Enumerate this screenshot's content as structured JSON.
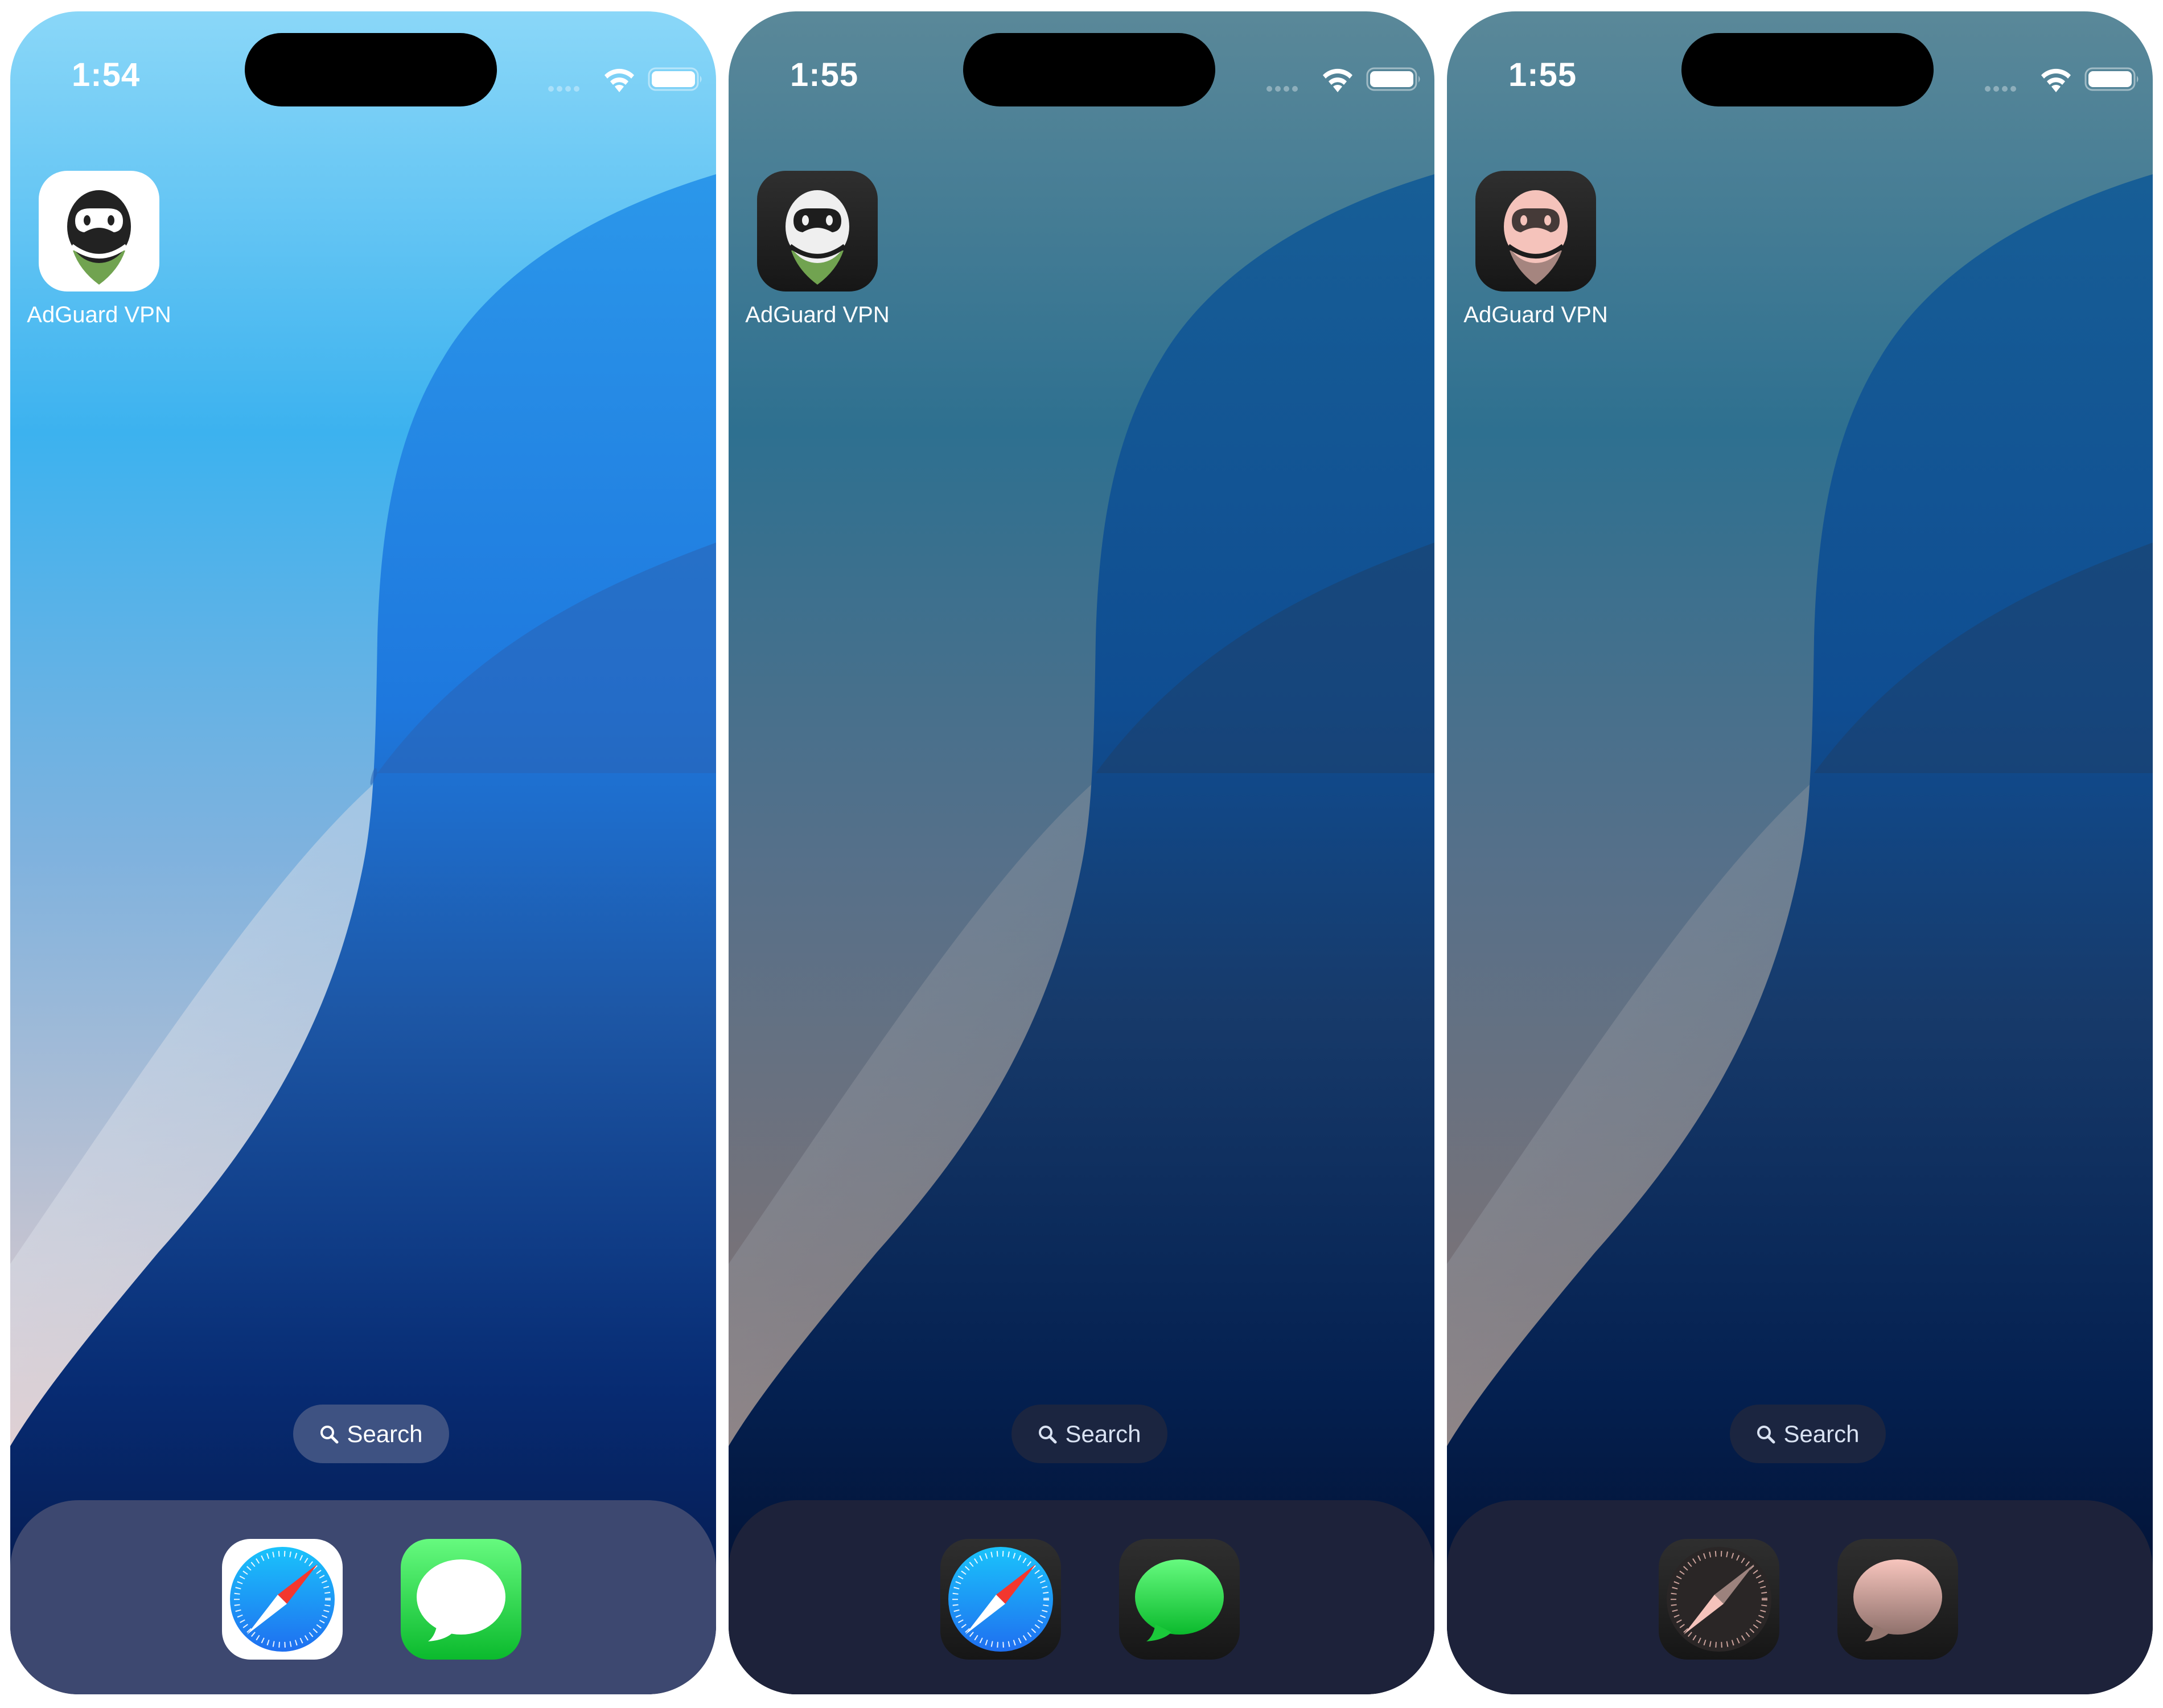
{
  "screens": [
    {
      "variant": "light",
      "time": "1:54",
      "app_label": "AdGuard VPN",
      "search_label": "Search",
      "dock_apps": [
        "Safari",
        "Messages"
      ],
      "battery_level": 1.0,
      "colors": {
        "wall_top": "#8ad7f8",
        "wall_mid": "#3cb2ef",
        "wall_blue": "#1f8de3",
        "wall_deep": "#0a2a6e",
        "wall_bottom": "#061640",
        "band_light": "#dfe8f2",
        "pink": "#f0c6c0",
        "dock": "#3d4971",
        "search_pill": "#3e5282"
      }
    },
    {
      "variant": "dark",
      "time": "1:55",
      "app_label": "AdGuard VPN",
      "search_label": "Search",
      "dock_apps": [
        "Safari",
        "Messages"
      ],
      "battery_level": 1.0,
      "colors": {
        "wall_top": "#5a8899",
        "wall_mid": "#2e7090",
        "wall_blue": "#14548c",
        "wall_deep": "#0b2a5c",
        "wall_bottom": "#020b26",
        "band_light": "#8e99a4",
        "pink": "#98807a",
        "dock": "#1d223a",
        "search_pill": "#1b2540"
      }
    },
    {
      "variant": "tinted",
      "time": "1:55",
      "app_label": "AdGuard VPN",
      "search_label": "Search",
      "dock_apps": [
        "Safari",
        "Messages"
      ],
      "battery_level": 1.0,
      "colors": {
        "wall_top": "#5a8899",
        "wall_mid": "#2e7090",
        "wall_blue": "#14548c",
        "wall_deep": "#0b2a5c",
        "wall_bottom": "#020b26",
        "band_light": "#8e99a4",
        "pink": "#98807a",
        "dock": "#1d223a",
        "search_pill": "#1b2540",
        "tint": "#f5c3bb"
      }
    }
  ],
  "icons": {
    "status": [
      "signal-dots-icon",
      "wifi-icon",
      "battery-icon"
    ],
    "search": "search-icon",
    "apps": [
      "adguard-vpn-icon",
      "safari-icon",
      "messages-icon"
    ]
  }
}
